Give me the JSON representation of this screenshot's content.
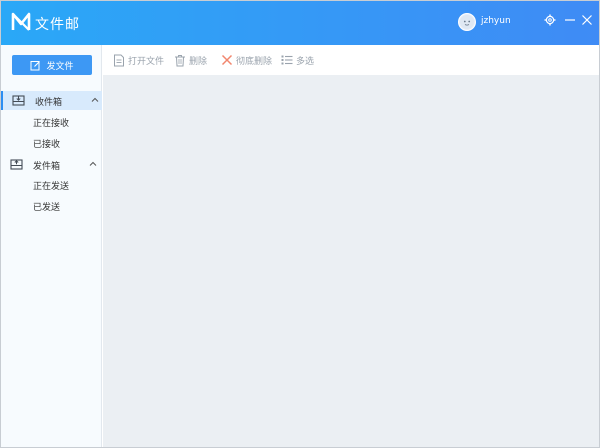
{
  "app": {
    "title": "文件邮"
  },
  "user": {
    "name": "jzhyun"
  },
  "sidebar": {
    "send_button_label": "发文件",
    "inbox": {
      "label": "收件箱",
      "items": [
        "正在接收",
        "已接收"
      ]
    },
    "outbox": {
      "label": "发件箱",
      "items": [
        "正在发送",
        "已发送"
      ]
    }
  },
  "toolbar": {
    "open_label": "打开文件",
    "delete_label": "删除",
    "perm_delete_label": "彻底删除",
    "multiselect_label": "多选"
  },
  "colors": {
    "title_gradient_start": "#2aa8f7",
    "title_gradient_end": "#3f8bf5",
    "accent": "#3d98f4",
    "delete_x": "#f2866e",
    "content_bg": "#ebeff3"
  }
}
